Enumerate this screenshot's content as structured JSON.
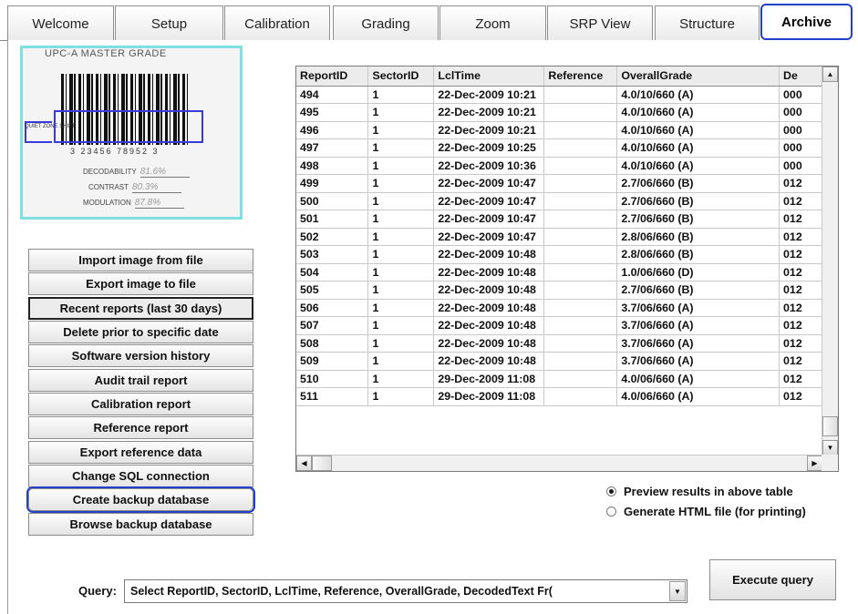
{
  "tabs": [
    {
      "label": "Welcome"
    },
    {
      "label": "Setup"
    },
    {
      "label": "Calibration"
    },
    {
      "label": "Grading"
    },
    {
      "label": "Zoom"
    },
    {
      "label": "SRP View"
    },
    {
      "label": "Structure"
    },
    {
      "label": "Archive",
      "active": true
    }
  ],
  "preview": {
    "title": "UPC-A MASTER GRADE",
    "digits": "3 23456 78952 3",
    "side_label": "QUIET ZONE SHIFT",
    "fields": [
      {
        "label": "DECODABILITY",
        "value": "81.6%"
      },
      {
        "label": "CONTRAST",
        "value": "80.3%"
      },
      {
        "label": "MODULATION",
        "value": "87.8%"
      }
    ]
  },
  "actions": [
    {
      "label": "Import image from file"
    },
    {
      "label": "Export image to file"
    },
    {
      "label": "Recent reports (last 30 days)",
      "pressed": true
    },
    {
      "label": "Delete prior to specific date"
    },
    {
      "label": "Software version history"
    },
    {
      "label": "Audit trail report"
    },
    {
      "label": "Calibration report"
    },
    {
      "label": "Reference report"
    },
    {
      "label": "Export reference data"
    },
    {
      "label": "Change SQL connection"
    },
    {
      "label": "Create backup database",
      "highlighted": true
    },
    {
      "label": "Browse backup database"
    }
  ],
  "table": {
    "columns": [
      "ReportID",
      "SectorID",
      "LclTime",
      "Reference",
      "OverallGrade",
      "De"
    ],
    "rows": [
      [
        "494",
        "1",
        "22-Dec-2009 10:21",
        "",
        "4.0/10/660 (A)",
        "000"
      ],
      [
        "495",
        "1",
        "22-Dec-2009 10:21",
        "",
        "4.0/10/660 (A)",
        "000"
      ],
      [
        "496",
        "1",
        "22-Dec-2009 10:21",
        "",
        "4.0/10/660 (A)",
        "000"
      ],
      [
        "497",
        "1",
        "22-Dec-2009 10:25",
        "",
        "4.0/10/660 (A)",
        "000"
      ],
      [
        "498",
        "1",
        "22-Dec-2009 10:36",
        "",
        "4.0/10/660 (A)",
        "000"
      ],
      [
        "499",
        "1",
        "22-Dec-2009 10:47",
        "",
        "2.7/06/660 (B)",
        "012"
      ],
      [
        "500",
        "1",
        "22-Dec-2009 10:47",
        "",
        "2.7/06/660 (B)",
        "012"
      ],
      [
        "501",
        "1",
        "22-Dec-2009 10:47",
        "",
        "2.7/06/660 (B)",
        "012"
      ],
      [
        "502",
        "1",
        "22-Dec-2009 10:47",
        "",
        "2.8/06/660 (B)",
        "012"
      ],
      [
        "503",
        "1",
        "22-Dec-2009 10:48",
        "",
        "2.8/06/660 (B)",
        "012"
      ],
      [
        "504",
        "1",
        "22-Dec-2009 10:48",
        "",
        "1.0/06/660 (D)",
        "012"
      ],
      [
        "505",
        "1",
        "22-Dec-2009 10:48",
        "",
        "2.7/06/660 (B)",
        "012"
      ],
      [
        "506",
        "1",
        "22-Dec-2009 10:48",
        "",
        "3.7/06/660 (A)",
        "012"
      ],
      [
        "507",
        "1",
        "22-Dec-2009 10:48",
        "",
        "3.7/06/660 (A)",
        "012"
      ],
      [
        "508",
        "1",
        "22-Dec-2009 10:48",
        "",
        "3.7/06/660 (A)",
        "012"
      ],
      [
        "509",
        "1",
        "22-Dec-2009 10:48",
        "",
        "3.7/06/660 (A)",
        "012"
      ],
      [
        "510",
        "1",
        "29-Dec-2009 11:08",
        "",
        "4.0/06/660 (A)",
        "012"
      ],
      [
        "511",
        "1",
        "29-Dec-2009 11:08",
        "",
        "4.0/06/660 (A)",
        "012"
      ]
    ]
  },
  "options": [
    {
      "label": "Preview results in above table",
      "checked": true
    },
    {
      "label": "Generate HTML file (for printing)",
      "checked": false
    }
  ],
  "query": {
    "label": "Query:",
    "value": "Select ReportID, SectorID, LclTime, Reference, OverallGrade, DecodedText Fr("
  },
  "execute_label": "Execute query",
  "colors": {
    "highlight": "#2340c8",
    "preview_border": "#7ee0e3"
  }
}
